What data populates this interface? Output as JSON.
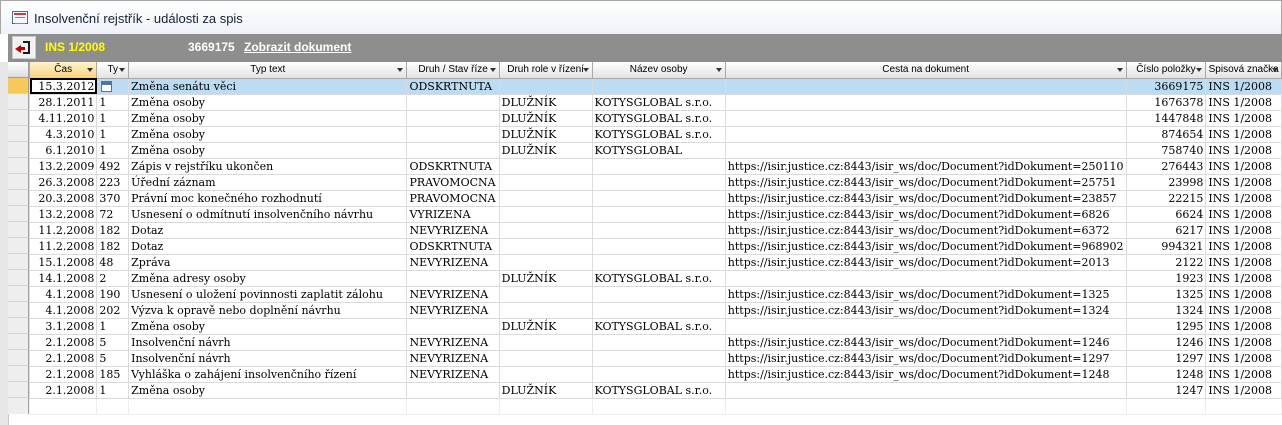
{
  "window": {
    "title": "Insolvenční rejstřík - události za spis"
  },
  "header": {
    "case": "INS 1/2008",
    "doc_number": "3669175",
    "show_doc_link": "Zobrazit dokument"
  },
  "columns": [
    "Čas",
    "Ty",
    "Typ text",
    "Druh / Stav říze",
    "Druh role v řízení",
    "Název osoby",
    "Cesta na dokument",
    "Číslo položky",
    "Spisová značka"
  ],
  "rows": [
    [
      "15.3.2012",
      "",
      "Změna senátu věci",
      "ODSKRTNUTA",
      "",
      "",
      "",
      "3669175",
      "INS 1/2008"
    ],
    [
      "28.1.2011",
      "1",
      "Změna osoby",
      "",
      "DLUŽNÍK",
      "KOTYSGLOBAL s.r.o.",
      "",
      "1676378",
      "INS 1/2008"
    ],
    [
      "4.11.2010",
      "1",
      "Změna osoby",
      "",
      "DLUŽNÍK",
      "KOTYSGLOBAL s.r.o.",
      "",
      "1447848",
      "INS 1/2008"
    ],
    [
      "4.3.2010",
      "1",
      "Změna osoby",
      "",
      "DLUŽNÍK",
      "KOTYSGLOBAL s.r.o.",
      "",
      "874654",
      "INS 1/2008"
    ],
    [
      "6.1.2010",
      "1",
      "Změna osoby",
      "",
      "DLUŽNÍK",
      "KOTYSGLOBAL",
      "",
      "758740",
      "INS 1/2008"
    ],
    [
      "13.2.2009",
      "492",
      "Zápis v rejstříku ukončen",
      "ODSKRTNUTA",
      "",
      "",
      "https://isir.justice.cz:8443/isir_ws/doc/Document?idDokument=250110",
      "276443",
      "INS 1/2008"
    ],
    [
      "26.3.2008",
      "223",
      "Úřední záznam",
      "PRAVOMOCNA",
      "",
      "",
      "https://isir.justice.cz:8443/isir_ws/doc/Document?idDokument=25751",
      "23998",
      "INS 1/2008"
    ],
    [
      "20.3.2008",
      "370",
      "Právní moc konečného rozhodnutí",
      "PRAVOMOCNA",
      "",
      "",
      "https://isir.justice.cz:8443/isir_ws/doc/Document?idDokument=23857",
      "22215",
      "INS 1/2008"
    ],
    [
      "13.2.2008",
      "72",
      "Usnesení o odmítnutí insolvenčního návrhu",
      "VYRIZENA",
      "",
      "",
      "https://isir.justice.cz:8443/isir_ws/doc/Document?idDokument=6826",
      "6624",
      "INS 1/2008"
    ],
    [
      "11.2.2008",
      "182",
      "Dotaz",
      "NEVYRIZENA",
      "",
      "",
      "https://isir.justice.cz:8443/isir_ws/doc/Document?idDokument=6372",
      "6217",
      "INS 1/2008"
    ],
    [
      "11.2.2008",
      "182",
      "Dotaz",
      "ODSKRTNUTA",
      "",
      "",
      "https://isir.justice.cz:8443/isir_ws/doc/Document?idDokument=968902",
      "994321",
      "INS 1/2008"
    ],
    [
      "15.1.2008",
      "48",
      "Zpráva",
      "NEVYRIZENA",
      "",
      "",
      "https://isir.justice.cz:8443/isir_ws/doc/Document?idDokument=2013",
      "2122",
      "INS 1/2008"
    ],
    [
      "14.1.2008",
      "2",
      "Změna adresy osoby",
      "",
      "DLUŽNÍK",
      "KOTYSGLOBAL s.r.o.",
      "",
      "1923",
      "INS 1/2008"
    ],
    [
      "4.1.2008",
      "190",
      "Usnesení o uložení povinnosti zaplatit zálohu",
      "NEVYRIZENA",
      "",
      "",
      "https://isir.justice.cz:8443/isir_ws/doc/Document?idDokument=1325",
      "1325",
      "INS 1/2008"
    ],
    [
      "4.1.2008",
      "202",
      "Výzva k opravě nebo doplnění návrhu",
      "NEVYRIZENA",
      "",
      "",
      "https://isir.justice.cz:8443/isir_ws/doc/Document?idDokument=1324",
      "1324",
      "INS 1/2008"
    ],
    [
      "3.1.2008",
      "1",
      "Změna osoby",
      "",
      "DLUŽNÍK",
      "KOTYSGLOBAL s.r.o.",
      "",
      "1295",
      "INS 1/2008"
    ],
    [
      "2.1.2008",
      "5",
      "Insolvenční návrh",
      "NEVYRIZENA",
      "",
      "",
      "https://isir.justice.cz:8443/isir_ws/doc/Document?idDokument=1246",
      "1246",
      "INS 1/2008"
    ],
    [
      "2.1.2008",
      "5",
      "Insolvenční návrh",
      "NEVYRIZENA",
      "",
      "",
      "https://isir.justice.cz:8443/isir_ws/doc/Document?idDokument=1297",
      "1297",
      "INS 1/2008"
    ],
    [
      "2.1.2008",
      "185",
      "Vyhláška o zahájení insolvenčního řízení",
      "NEVYRIZENA",
      "",
      "",
      "https://isir.justice.cz:8443/isir_ws/doc/Document?idDokument=1248",
      "1248",
      "INS 1/2008"
    ],
    [
      "2.1.2008",
      "1",
      "Změna osoby",
      "",
      "DLUŽNÍK",
      "KOTYSGLOBAL s.r.o.",
      "",
      "1247",
      "INS 1/2008"
    ]
  ],
  "ui": {
    "selected_row": 0,
    "selection_color": "#bcdcf4",
    "sorted_header_color": "#f8d27e",
    "header_bar_color": "#8e8e8e",
    "case_label_color": "#ffff00"
  }
}
